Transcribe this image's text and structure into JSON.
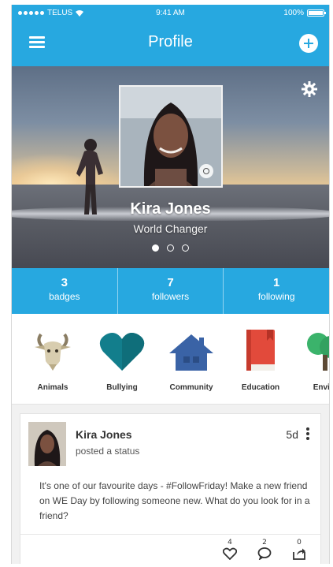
{
  "status_bar": {
    "carrier": "TELUS",
    "time": "9:41 AM",
    "battery": "100%",
    "battery_level": 1.0
  },
  "header": {
    "title": "Profile",
    "menu_icon": "hamburger-icon",
    "add_icon": "plus-circle-icon"
  },
  "profile": {
    "name": "Kira Jones",
    "subtitle": "World Changer",
    "settings_icon": "gear-icon",
    "camera_icon": "camera-icon",
    "pager_count": 3,
    "pager_active": 0
  },
  "stats": [
    {
      "value": "3",
      "label": "badges"
    },
    {
      "value": "7",
      "label": "followers"
    },
    {
      "value": "1",
      "label": "following"
    }
  ],
  "categories": [
    {
      "label": "Animals",
      "icon": "goat-icon",
      "color": "#cbbf9e"
    },
    {
      "label": "Bullying",
      "icon": "heart-icon",
      "color": "#127e8c"
    },
    {
      "label": "Community",
      "icon": "house-icon",
      "color": "#3a63a6"
    },
    {
      "label": "Education",
      "icon": "book-icon",
      "color": "#e24a3b"
    },
    {
      "label": "Envira",
      "icon": "tree-icon",
      "color": "#3bb36b"
    }
  ],
  "post": {
    "author": "Kira Jones",
    "action": "posted a status",
    "time": "5d",
    "body": "It's one of our favourite days - #FollowFriday! Make a new friend on WE Day by following someone new. What do you look for in a friend?",
    "likes": "4",
    "comments": "2",
    "shares": "0"
  },
  "colors": {
    "brand": "#27a8e0"
  }
}
